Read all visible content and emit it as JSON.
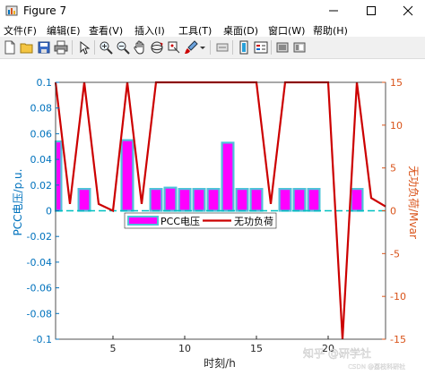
{
  "window": {
    "title": "Figure 7"
  },
  "menu": [
    "文件(F)",
    "编辑(E)",
    "查看(V)",
    "插入(I)",
    "工具(T)",
    "桌面(D)",
    "窗口(W)",
    "帮助(H)"
  ],
  "watermark": {
    "main": "知乎 @研学社",
    "sub": "CSDN @荔枝科研社"
  },
  "colors": {
    "bar_fill": "#ff00ff",
    "bar_edge": "#4fc3d9",
    "line": "#cc0000",
    "left_axis": "#0072bd",
    "right_axis": "#d95319",
    "zero_line": "#00c0c0"
  },
  "chart_data": {
    "type": "bar+line",
    "xlabel": "时刻/h",
    "ylabel_left": "PCC电压/p.u.",
    "ylabel_right": "无功负荷/Mvar",
    "xlim": [
      1,
      24
    ],
    "ylim_left": [
      -0.1,
      0.1
    ],
    "ylim_right": [
      -15,
      15
    ],
    "x_ticks": [
      5,
      10,
      15,
      20
    ],
    "y_ticks_left": [
      "0.1",
      "0.08",
      "0.06",
      "0.04",
      "0.02",
      "0",
      "-0.02",
      "-0.04",
      "-0.06",
      "-0.08",
      "-0.1"
    ],
    "y_ticks_right": [
      "15",
      "10",
      "5",
      "0",
      "-5",
      "-10",
      "-15"
    ],
    "legend_position": "center-left",
    "x": [
      1,
      2,
      3,
      4,
      5,
      6,
      7,
      8,
      9,
      10,
      11,
      12,
      13,
      14,
      15,
      16,
      17,
      18,
      19,
      20,
      21,
      22,
      23,
      24
    ],
    "series": [
      {
        "name": "PCC电压",
        "type": "bar",
        "axis": "left",
        "values": [
          0.054,
          0,
          0.017,
          0,
          0,
          0.055,
          0,
          0.017,
          0.018,
          0.017,
          0.017,
          0.017,
          0.053,
          0.017,
          0.017,
          0,
          0.017,
          0.017,
          0.017,
          0,
          0,
          0.017,
          0,
          0
        ]
      },
      {
        "name": "无功负荷",
        "type": "line",
        "axis": "right",
        "values": [
          15,
          0.8,
          15,
          0.8,
          0,
          15,
          0.8,
          15,
          15,
          15,
          15,
          15,
          15,
          15,
          15,
          0.8,
          15,
          15,
          15,
          15,
          -15,
          15,
          1.5,
          0.5
        ]
      }
    ]
  }
}
